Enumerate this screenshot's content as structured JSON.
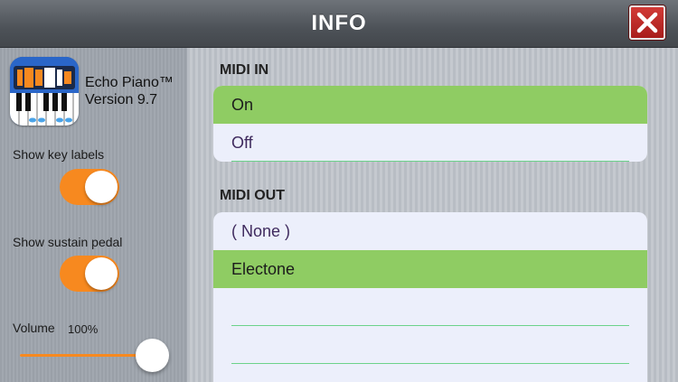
{
  "header": {
    "title": "INFO"
  },
  "app": {
    "name": "Echo Piano™",
    "version": "Version 9.7",
    "icon": "echo-piano-app-icon"
  },
  "settings": {
    "key_labels": {
      "label": "Show key labels",
      "on": true
    },
    "sustain_pedal": {
      "label": "Show sustain pedal",
      "on": true
    },
    "volume": {
      "label": "Volume",
      "value_text": "100%",
      "value": 1.0
    }
  },
  "midi_in": {
    "title": "MIDI IN",
    "options": [
      {
        "label": "On",
        "selected": true
      },
      {
        "label": "Off",
        "selected": false
      }
    ]
  },
  "midi_out": {
    "title": "MIDI OUT",
    "options": [
      {
        "label": "( None )",
        "selected": false
      },
      {
        "label": "Electone",
        "selected": true
      },
      {
        "label": "",
        "selected": false
      },
      {
        "label": "",
        "selected": false
      }
    ]
  },
  "colors": {
    "accent": "#f7891f",
    "selected_row": "#8fcc63",
    "close": "#c0302c"
  }
}
